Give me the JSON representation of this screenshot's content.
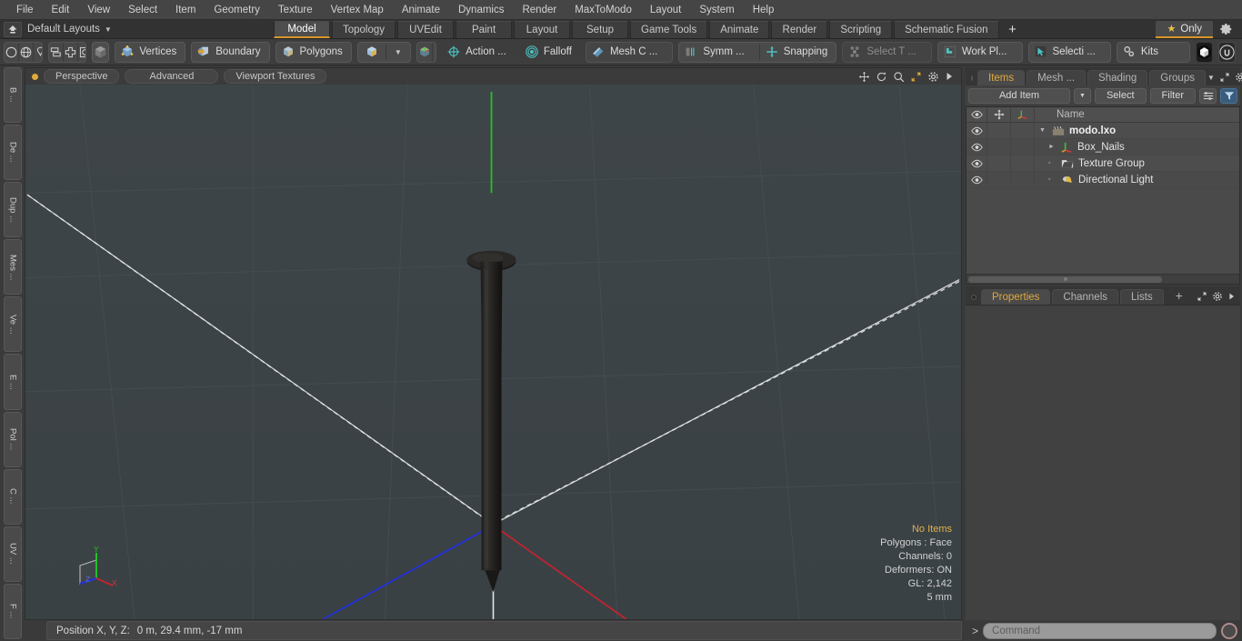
{
  "menubar": {
    "items": [
      "File",
      "Edit",
      "View",
      "Select",
      "Item",
      "Geometry",
      "Texture",
      "Vertex Map",
      "Animate",
      "Dynamics",
      "Render",
      "MaxToModo",
      "Layout",
      "System",
      "Help"
    ]
  },
  "layoutbar": {
    "layout_label": "Default Layouts",
    "tabs": [
      {
        "label": "Model",
        "active": true
      },
      {
        "label": "Topology",
        "active": false
      },
      {
        "label": "UVEdit",
        "active": false
      },
      {
        "label": "Paint",
        "active": false
      },
      {
        "label": "Layout",
        "active": false
      },
      {
        "label": "Setup",
        "active": false
      },
      {
        "label": "Game Tools",
        "active": false
      },
      {
        "label": "Animate",
        "active": false
      },
      {
        "label": "Render",
        "active": false
      },
      {
        "label": "Scripting",
        "active": false
      },
      {
        "label": "Schematic Fusion",
        "active": false
      }
    ],
    "add_tab_label": "+",
    "only_label": "Only"
  },
  "toolbar": {
    "selection_modes": [
      "circle-select-icon",
      "globe-select-icon",
      "lasso-select-icon",
      "paint-select-icon"
    ],
    "component_modes": [
      "stack-icon",
      "cross-icon",
      "square-in-square-icon",
      "circle-in-square-icon"
    ],
    "buttons": [
      {
        "label": "Vertices",
        "icon": "cube-vertices-icon",
        "dim": false
      },
      {
        "label": "Boundary",
        "icon": "cube-boundary-icon",
        "dim": false
      },
      {
        "label": "Polygons",
        "icon": "cube-polygons-icon",
        "dim": false
      },
      {
        "label": "Action  ...",
        "icon": "action-center-icon",
        "dim": false
      },
      {
        "label": "Falloff",
        "icon": "falloff-icon",
        "dim": false
      },
      {
        "label": "Mesh C ...",
        "icon": "mesh-constraint-icon",
        "dim": false
      },
      {
        "label": "Symm ...",
        "icon": "symmetry-icon",
        "dim": false
      },
      {
        "label": "Snapping",
        "icon": "snapping-icon",
        "dim": false
      },
      {
        "label": "Select T ...",
        "icon": "select-through-icon",
        "dim": true
      },
      {
        "label": "Work Pl...",
        "icon": "work-plane-icon",
        "dim": false
      },
      {
        "label": "Selecti  ...",
        "icon": "selection-set-icon",
        "dim": false
      },
      {
        "label": "Kits",
        "icon": "gears-icon",
        "dim": false
      }
    ]
  },
  "left_strip": {
    "tabs": [
      "B ...",
      "De ...",
      "Dup ...",
      "Mes ...",
      "Ve ...",
      "E ...",
      "Pol ...",
      "C ...",
      "UV ...",
      "F ..."
    ]
  },
  "viewport": {
    "header_pills": [
      "Perspective",
      "Advanced",
      "Viewport Textures"
    ],
    "header_icons": [
      "move-icon",
      "rotate-icon",
      "zoom-icon",
      "maximize-icon",
      "gear-icon",
      "chevron-right-icon"
    ],
    "info": {
      "items_label": "No Items",
      "polygons": "Polygons : Face",
      "channels": "Channels: 0",
      "deformers": "Deformers: ON",
      "gl": "GL: 2,142",
      "scale": "5 mm"
    },
    "axis_labels": {
      "x": "X",
      "y": "Y",
      "z": "Z"
    },
    "colors": {
      "x_axis": "#c4303a",
      "y_axis": "#2fb92f",
      "z_axis": "#2f46d6",
      "background": "#3c4347"
    }
  },
  "statusbar": {
    "position_label": "Position X, Y, Z:",
    "position_value": "0 m, 29.4 mm, -17 mm"
  },
  "right_panel": {
    "top_tabs": [
      {
        "label": "Items",
        "active": true
      },
      {
        "label": "Mesh ...",
        "active": false
      },
      {
        "label": "Shading",
        "active": false
      },
      {
        "label": "Groups",
        "active": false
      }
    ],
    "controls": {
      "add_item": "Add Item",
      "select": "Select",
      "filter": "Filter"
    },
    "list_columns": {
      "eye": "eye-icon",
      "position": "move-handle-icon",
      "axis": "axis-icon",
      "name": "Name"
    },
    "items": [
      {
        "name": "modo.lxo",
        "icon": "scene-clapper-icon",
        "level": 0,
        "expanded": true,
        "root": true,
        "selected": false
      },
      {
        "name": "Box_Nails",
        "icon": "mesh-axis-icon",
        "level": 1,
        "expanded": false,
        "root": false,
        "selected": false
      },
      {
        "name": "Texture Group",
        "icon": "texture-group-icon",
        "level": 1,
        "expanded": null,
        "root": false,
        "selected": false
      },
      {
        "name": "Directional Light",
        "icon": "directional-light-icon",
        "level": 1,
        "expanded": null,
        "root": false,
        "selected": false
      }
    ],
    "bottom_tabs": [
      {
        "label": "Properties",
        "active": true
      },
      {
        "label": "Channels",
        "active": false
      },
      {
        "label": "Lists",
        "active": false
      },
      {
        "label": "+",
        "active": false
      }
    ]
  },
  "command_bar": {
    "prompt": "&gt;",
    "placeholder": "Command",
    "value": ""
  }
}
